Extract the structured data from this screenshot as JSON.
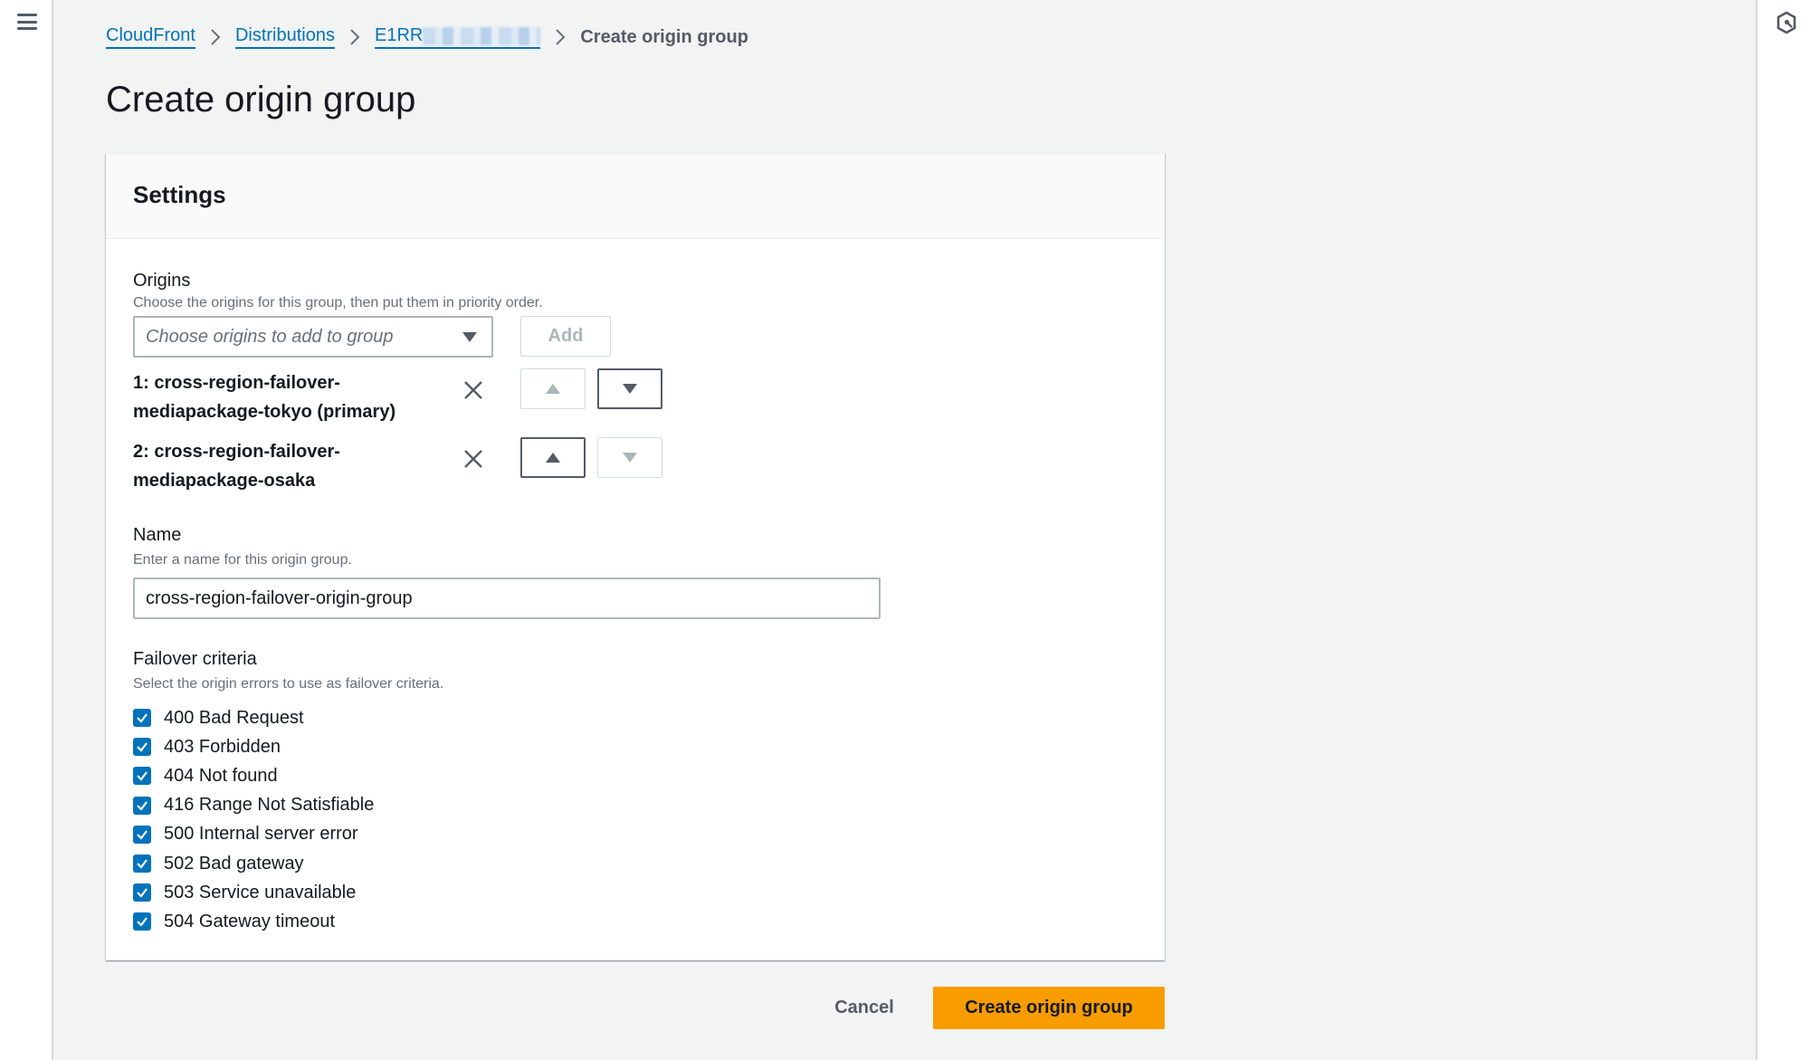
{
  "breadcrumb": {
    "items": [
      {
        "label": "CloudFront"
      },
      {
        "label": "Distributions"
      },
      {
        "label": "E1RR",
        "redacted_suffix": true
      }
    ],
    "current": "Create origin group"
  },
  "page": {
    "title": "Create origin group"
  },
  "settings": {
    "header": "Settings",
    "origins": {
      "label": "Origins",
      "description": "Choose the origins for this group, then put them in priority order.",
      "select_placeholder": "Choose origins to add to group",
      "add_button": "Add",
      "list": [
        {
          "line1": "1: cross-region-failover-",
          "line2": "mediapackage-tokyo (primary)",
          "up_enabled": false,
          "down_enabled": true
        },
        {
          "line1": "2: cross-region-failover-",
          "line2": "mediapackage-osaka",
          "up_enabled": true,
          "down_enabled": false
        }
      ]
    },
    "name": {
      "label": "Name",
      "description": "Enter a name for this origin group.",
      "value": "cross-region-failover-origin-group"
    },
    "failover": {
      "label": "Failover criteria",
      "description": "Select the origin errors to use as failover criteria.",
      "options": [
        {
          "label": "400 Bad Request",
          "checked": true
        },
        {
          "label": "403 Forbidden",
          "checked": true
        },
        {
          "label": "404 Not found",
          "checked": true
        },
        {
          "label": "416 Range Not Satisfiable",
          "checked": true
        },
        {
          "label": "500 Internal server error",
          "checked": true
        },
        {
          "label": "502 Bad gateway",
          "checked": true
        },
        {
          "label": "503 Service unavailable",
          "checked": true
        },
        {
          "label": "504 Gateway timeout",
          "checked": true
        }
      ]
    }
  },
  "actions": {
    "cancel": "Cancel",
    "submit": "Create origin group"
  },
  "icons": {
    "menu": "hamburger-menu-icon",
    "help": "help-hexagon-icon",
    "separator": "chevron-right-icon",
    "remove": "close-x-icon",
    "move_up": "caret-up-icon",
    "move_down": "caret-down-icon",
    "check": "checkmark-icon"
  },
  "colors": {
    "link": "#0073bb",
    "primary_button": "#f89c00",
    "checkbox": "#0073bb",
    "background": "#f2f3f3"
  }
}
